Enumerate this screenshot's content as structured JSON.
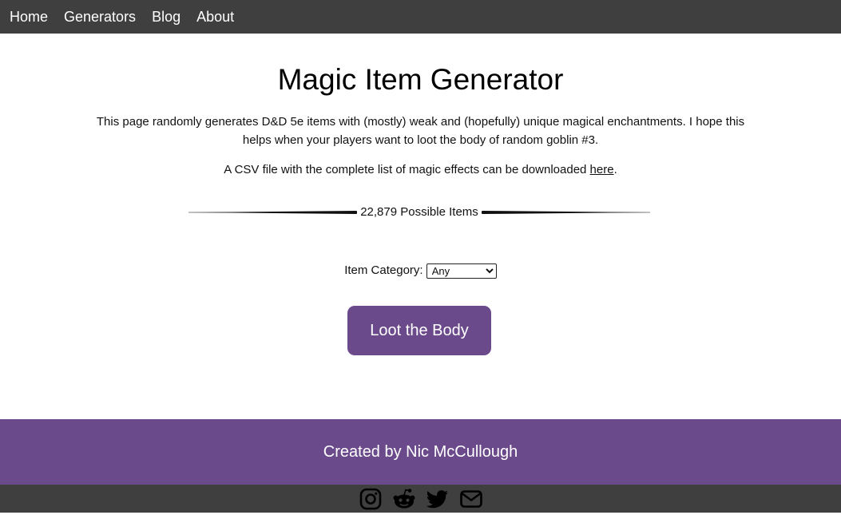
{
  "nav": {
    "items": [
      {
        "label": "Home"
      },
      {
        "label": "Generators"
      },
      {
        "label": "Blog"
      },
      {
        "label": "About"
      }
    ]
  },
  "main": {
    "title": "Magic Item Generator",
    "intro": "This page randomly generates D&D 5e items with (mostly) weak and (hopefully) unique magical enchantments. I hope this helps when your players want to loot the body of random goblin #3.",
    "csv_text": "A CSV file with the complete list of magic effects can be downloaded ",
    "csv_link": "here",
    "csv_end": ".",
    "possible_items": "22,879 Possible Items",
    "category_label": "Item Category:",
    "category_selected": "Any",
    "button_label": "Loot the Body"
  },
  "footer": {
    "credit": "Created by Nic McCullough"
  },
  "social": {
    "icons": [
      "instagram-icon",
      "reddit-icon",
      "twitter-icon",
      "email-icon"
    ]
  },
  "colors": {
    "nav_bg": "#3f3f3f",
    "accent": "#6b4a8c",
    "text": "#111111"
  }
}
